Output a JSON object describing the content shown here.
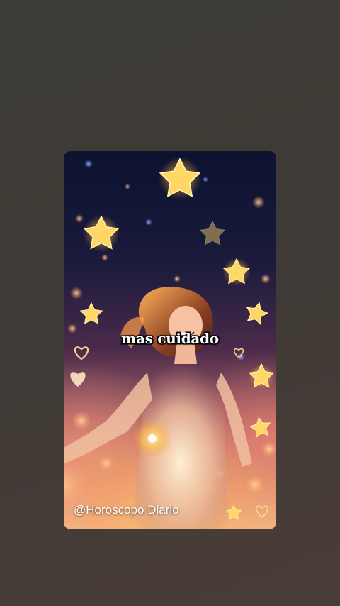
{
  "video": {
    "caption": "mas cuidado",
    "watermark": "@Horoscopo Diario"
  },
  "background": {
    "outer_color": "#3e3b36",
    "sky_top": "#0c1230",
    "glow": "#f0b488"
  }
}
